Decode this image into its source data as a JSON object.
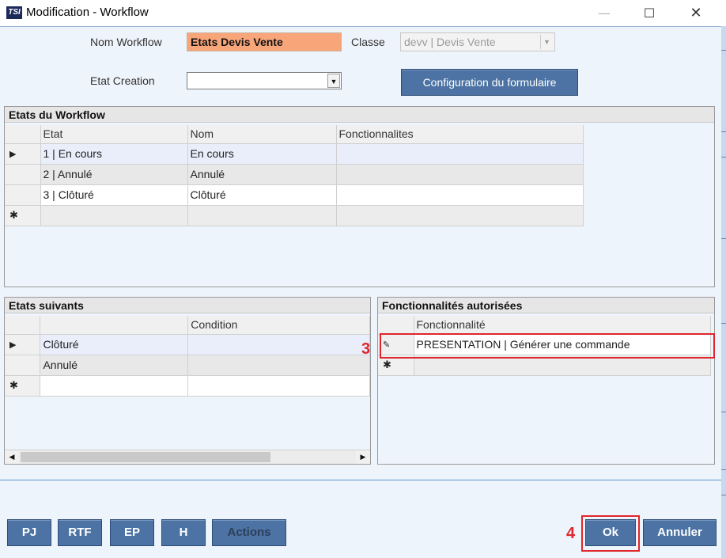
{
  "window": {
    "icon_text": "TSI",
    "title": "Modification - Workflow",
    "minimize_glyph": "—",
    "maximize_glyph": "☐",
    "close_glyph": "✕"
  },
  "form": {
    "nom_label": "Nom Workflow",
    "nom_value": "Etats Devis Vente",
    "classe_label": "Classe",
    "classe_value": "devv | Devis Vente",
    "etat_creation_label": "Etat Creation",
    "etat_creation_value": "",
    "config_button": "Configuration du formulaire",
    "dropdown_glyph": "▼"
  },
  "etats_workflow": {
    "title": "Etats du Workflow",
    "columns": [
      "Etat",
      "Nom",
      "Fonctionnalites"
    ],
    "rows": [
      {
        "etat": "1 | En cours",
        "nom": "En cours",
        "fonct": ""
      },
      {
        "etat": "2 | Annulé",
        "nom": "Annulé",
        "fonct": ""
      },
      {
        "etat": "3 | Clôturé",
        "nom": "Clôturé",
        "fonct": ""
      }
    ],
    "current_marker": "▶",
    "new_row_marker": "✱"
  },
  "etats_suivants": {
    "title": "Etats suivants",
    "columns": [
      "",
      "Condition"
    ],
    "rows": [
      {
        "etat": "Clôturé",
        "condition": ""
      },
      {
        "etat": "Annulé",
        "condition": ""
      }
    ],
    "current_marker": "▶",
    "new_row_marker": "✱",
    "scroll_left": "◀",
    "scroll_right": "▶"
  },
  "fonctionnalites": {
    "title": "Fonctionnalités autorisées",
    "column": "Fonctionnalité",
    "rows": [
      {
        "value": "PRESENTATION | Générer une commande"
      }
    ],
    "edit_marker": "✎",
    "new_row_marker": "✱"
  },
  "annotations": {
    "step3": "3",
    "step4": "4",
    "annotation_color": "#e0262d"
  },
  "footer": {
    "pj": "PJ",
    "rtf": "RTF",
    "ep": "EP",
    "h": "H",
    "actions": "Actions",
    "ok": "Ok",
    "annuler": "Annuler"
  },
  "colors": {
    "accent_button": "#4c73a4",
    "nom_field_bg": "#f9a57a",
    "client_bg": "#eef4fb"
  }
}
